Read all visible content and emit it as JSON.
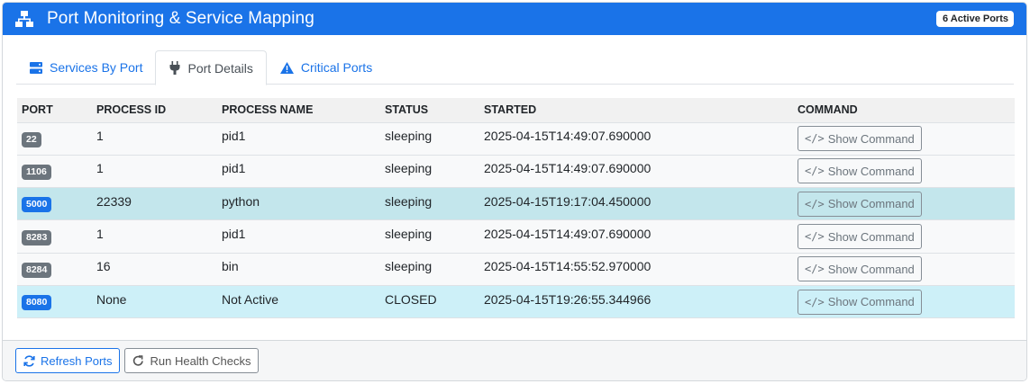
{
  "header": {
    "title": "Port Monitoring & Service Mapping",
    "active_badge": "6 Active Ports",
    "icon": "network-icon"
  },
  "tabs": [
    {
      "label": "Services By Port",
      "icon": "server-icon",
      "active": false
    },
    {
      "label": "Port Details",
      "icon": "plug-icon",
      "active": true
    },
    {
      "label": "Critical Ports",
      "icon": "warning-icon",
      "active": false
    }
  ],
  "table": {
    "columns": [
      "PORT",
      "PROCESS ID",
      "PROCESS NAME",
      "STATUS",
      "STARTED",
      "COMMAND"
    ],
    "command_label": "Show Command",
    "rows": [
      {
        "port": "22",
        "pid": "1",
        "name": "pid1",
        "status": "sleeping",
        "started": "2025-04-15T14:49:07.690000",
        "highlight": "none",
        "badge": "gray"
      },
      {
        "port": "1106",
        "pid": "1",
        "name": "pid1",
        "status": "sleeping",
        "started": "2025-04-15T14:49:07.690000",
        "highlight": "none",
        "badge": "gray"
      },
      {
        "port": "5000",
        "pid": "22339",
        "name": "python",
        "status": "sleeping",
        "started": "2025-04-15T19:17:04.450000",
        "highlight": "teal",
        "badge": "blue"
      },
      {
        "port": "8283",
        "pid": "1",
        "name": "pid1",
        "status": "sleeping",
        "started": "2025-04-15T14:49:07.690000",
        "highlight": "none",
        "badge": "gray"
      },
      {
        "port": "8284",
        "pid": "16",
        "name": "bin",
        "status": "sleeping",
        "started": "2025-04-15T14:55:52.970000",
        "highlight": "none",
        "badge": "gray"
      },
      {
        "port": "8080",
        "pid": "None",
        "name": "Not Active",
        "status": "CLOSED",
        "started": "2025-04-15T19:26:55.344966",
        "highlight": "cyan",
        "badge": "blue"
      }
    ]
  },
  "footer": {
    "refresh_label": "Refresh Ports",
    "health_label": "Run Health Checks"
  },
  "colors": {
    "primary": "#1a73e8",
    "badge_gray": "#6c757d",
    "row_teal": "#c3e6ec",
    "row_cyan": "#cdf0f8"
  }
}
